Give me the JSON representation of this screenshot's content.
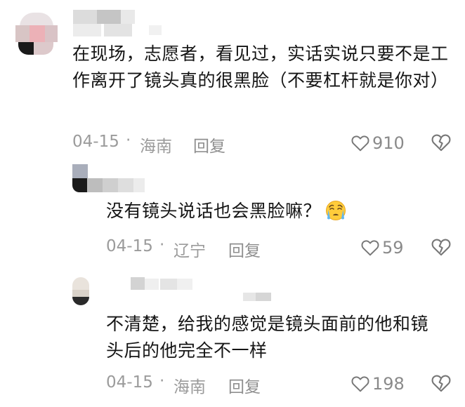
{
  "comments": [
    {
      "text": "在现场，志愿者，看见过，实话实说只要不是工作离开了镜头真的很黑脸（不要杠杆就是你对）",
      "time": "04-15",
      "separator": "·",
      "location": "海南",
      "reply_label": "回复",
      "likes": "910"
    },
    {
      "text": "没有镜头说话也会黑脸嘛？",
      "emoji": "crying-face-emoji",
      "time": "04-15",
      "separator": "·",
      "location": "辽宁",
      "reply_label": "回复",
      "likes": "59"
    },
    {
      "text": "不清楚，给我的感觉是镜头面前的他和镜头后的他完全不一样",
      "time": "04-15",
      "separator": "·",
      "location": "海南",
      "reply_label": "回复",
      "likes": "198"
    }
  ],
  "icons": {
    "like": "heart-outline-icon",
    "dislike": "broken-heart-icon"
  },
  "colors": {
    "text": "#151515",
    "meta": "#9b9b9b",
    "icon": "#777777"
  }
}
